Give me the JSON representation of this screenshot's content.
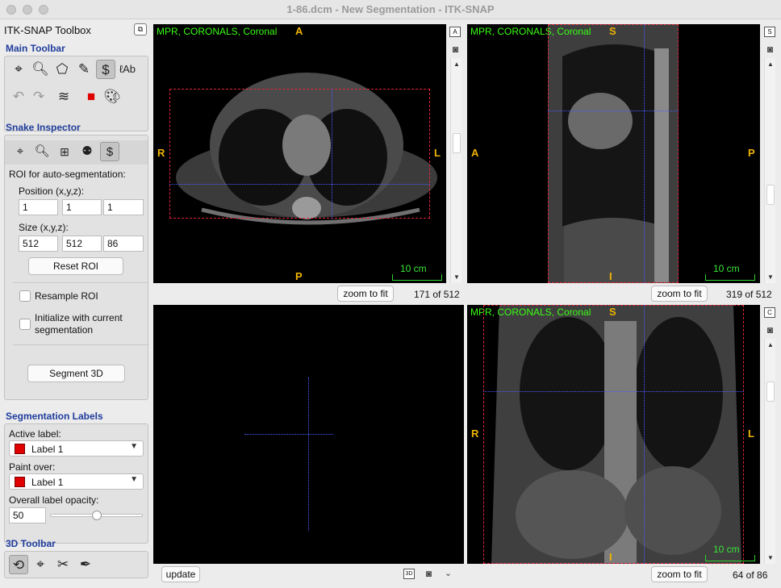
{
  "window": {
    "title": "1-86.dcm - New Segmentation - ITK-SNAP"
  },
  "toolbox": {
    "title": "ITK-SNAP Toolbox",
    "main_toolbar": {
      "heading": "Main Toolbar",
      "tools": [
        "crosshair-icon",
        "zoom-icon",
        "polygon-icon",
        "paintbrush-icon",
        "snake-icon",
        "annotation-icon"
      ],
      "actions": [
        "undo-icon",
        "redo-icon",
        "layers-icon",
        "label-color-icon",
        "palette-icon"
      ]
    },
    "snake_inspector": {
      "heading": "Snake Inspector",
      "roi_label": "ROI for auto-segmentation:",
      "position_label": "Position (x,y,z):",
      "position": [
        "1",
        "1",
        "1"
      ],
      "size_label": "Size (x,y,z):",
      "size": [
        "512",
        "512",
        "86"
      ],
      "reset_label": "Reset ROI",
      "resample_label": "Resample ROI",
      "init_label_1": "Initialize with current",
      "init_label_2": "segmentation",
      "segment_label": "Segment 3D"
    },
    "segmentation_labels": {
      "heading": "Segmentation Labels",
      "active_label_caption": "Active label:",
      "active_label": "Label 1",
      "paint_over_caption": "Paint over:",
      "paint_over": "Label 1",
      "opacity_caption": "Overall label opacity:",
      "opacity_value": "50",
      "opacity_fraction": 0.5,
      "label_color": "#e00000"
    },
    "toolbar_3d": {
      "heading": "3D Toolbar"
    }
  },
  "views": {
    "axial": {
      "label": "MPR, CORONALS, Coronal",
      "orient": {
        "top": "A",
        "bottom": "P",
        "left": "R",
        "right": "L"
      },
      "scale": "10 cm",
      "zoom_label": "zoom to fit",
      "slice": "171 of 512",
      "side_letter": "A"
    },
    "sagittal": {
      "label": "MPR, CORONALS, Coronal",
      "orient": {
        "top": "S",
        "bottom": "I",
        "left": "A",
        "right": "P"
      },
      "scale": "10 cm",
      "zoom_label": "zoom to fit",
      "slice": "319 of 512",
      "side_letter": "S"
    },
    "view3d": {
      "update_label": "update",
      "mode_label": "3D"
    },
    "coronal": {
      "label": "MPR, CORONALS, Coronal",
      "orient": {
        "top": "S",
        "bottom": "I",
        "left": "R",
        "right": "L"
      },
      "scale": "10 cm",
      "zoom_label": "zoom to fit",
      "slice": "64 of 86",
      "side_letter": "C"
    }
  },
  "colors": {
    "annotation_green": "#39ff14",
    "orientation": "#f0b400",
    "roi_red": "#e0243a",
    "crosshair_blue": "#4a5cff",
    "heading_blue": "#1f3c9c"
  }
}
